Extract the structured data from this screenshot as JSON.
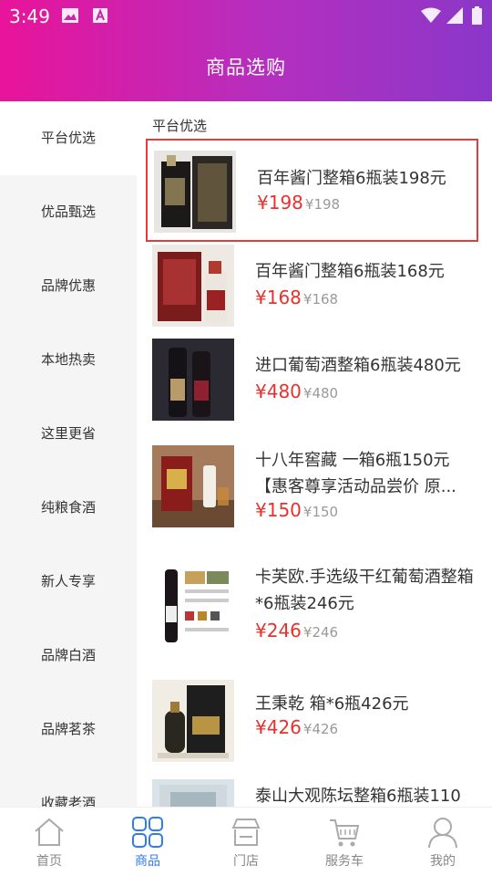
{
  "status": {
    "time": "3:49"
  },
  "header": {
    "title": "商品选购"
  },
  "sidebar": {
    "items": [
      {
        "label": "平台优选"
      },
      {
        "label": "优品甄选"
      },
      {
        "label": "品牌优惠"
      },
      {
        "label": "本地热卖"
      },
      {
        "label": "这里更省"
      },
      {
        "label": "纯粮食酒"
      },
      {
        "label": "新人专享"
      },
      {
        "label": "品牌白酒"
      },
      {
        "label": "品牌茗茶"
      },
      {
        "label": "收藏老酒"
      }
    ]
  },
  "main": {
    "section_title": "平台优选",
    "products": [
      {
        "name": "百年酱门整箱6瓶装198元",
        "price": "¥198",
        "orig_price": "¥198"
      },
      {
        "name": "百年酱门整箱6瓶装168元",
        "price": "¥168",
        "orig_price": "¥168"
      },
      {
        "name": "进口葡萄酒整箱6瓶装480元",
        "price": "¥480",
        "orig_price": "¥480"
      },
      {
        "name": "十八年窖藏 一箱6瓶150元【惠客尊享活动品尝价 原...",
        "price": "¥150",
        "orig_price": "¥150"
      },
      {
        "name": "卡芙欧.手选级干红葡萄酒整箱*6瓶装246元",
        "price": "¥246",
        "orig_price": "¥246"
      },
      {
        "name": "王秉乾 箱*6瓶426元",
        "price": "¥426",
        "orig_price": "¥426"
      },
      {
        "name": "泰山大观陈坛整箱6瓶装110",
        "price": "",
        "orig_price": ""
      }
    ]
  },
  "tabbar": {
    "tabs": [
      {
        "label": "首页",
        "icon": "home-icon"
      },
      {
        "label": "商品",
        "icon": "grid-icon"
      },
      {
        "label": "门店",
        "icon": "store-icon"
      },
      {
        "label": "服务车",
        "icon": "cart-icon"
      },
      {
        "label": "我的",
        "icon": "user-icon"
      }
    ],
    "active_color": "#2f7cf0",
    "inactive_color": "#888888"
  },
  "colors": {
    "accent": "#e8312c",
    "header_start": "#e8149a",
    "header_end": "#8a37c9"
  }
}
